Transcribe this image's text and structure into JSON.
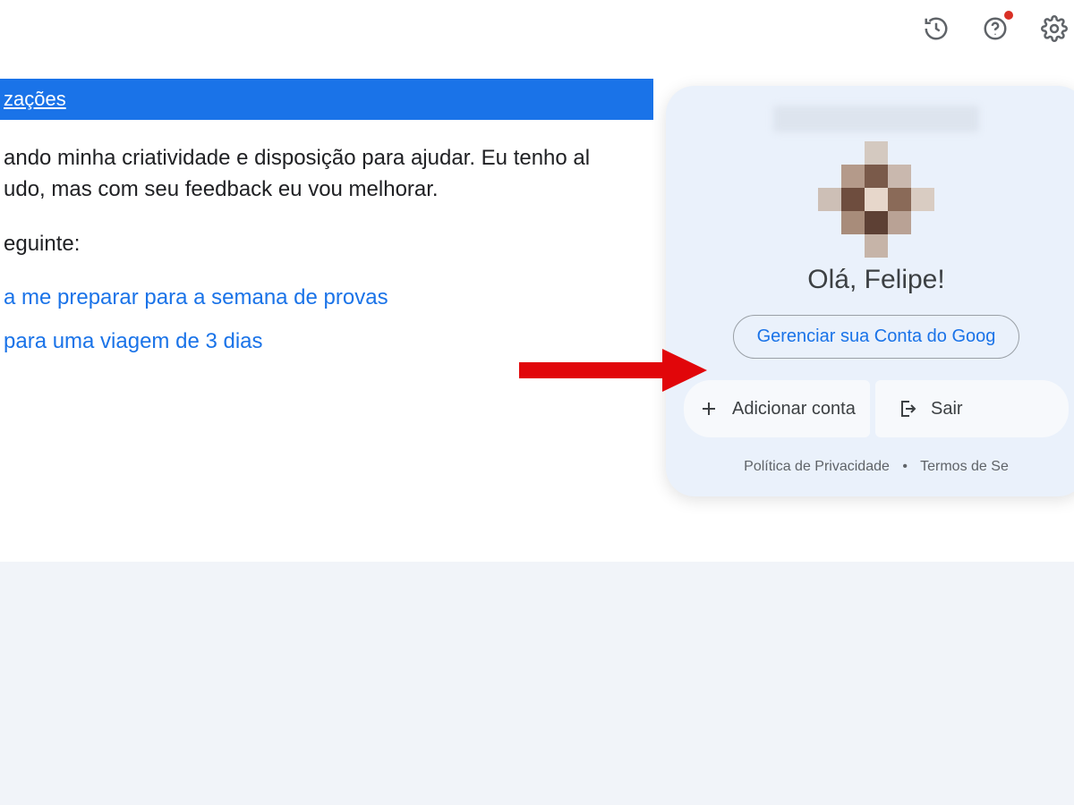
{
  "topbar": {
    "history_icon": "history-icon",
    "help_icon": "help-icon",
    "settings_icon": "settings-icon",
    "help_has_badge": true
  },
  "banner": {
    "link_text_fragment": "zações"
  },
  "content": {
    "line1": "ando minha criatividade e disposição para ajudar. Eu tenho al",
    "line2": "udo, mas com seu feedback eu vou melhorar.",
    "line3": "eguinte:",
    "suggestion1": "a me preparar para a semana de provas",
    "suggestion2": "para uma viagem de 3 dias"
  },
  "popover": {
    "greeting": "Olá, Felipe!",
    "manage_label": "Gerenciar sua Conta do Goog",
    "add_account_label": "Adicionar conta",
    "sign_out_label": "Sair",
    "privacy_label": "Política de Privacidade",
    "separator": "•",
    "terms_label": "Termos de Se"
  }
}
